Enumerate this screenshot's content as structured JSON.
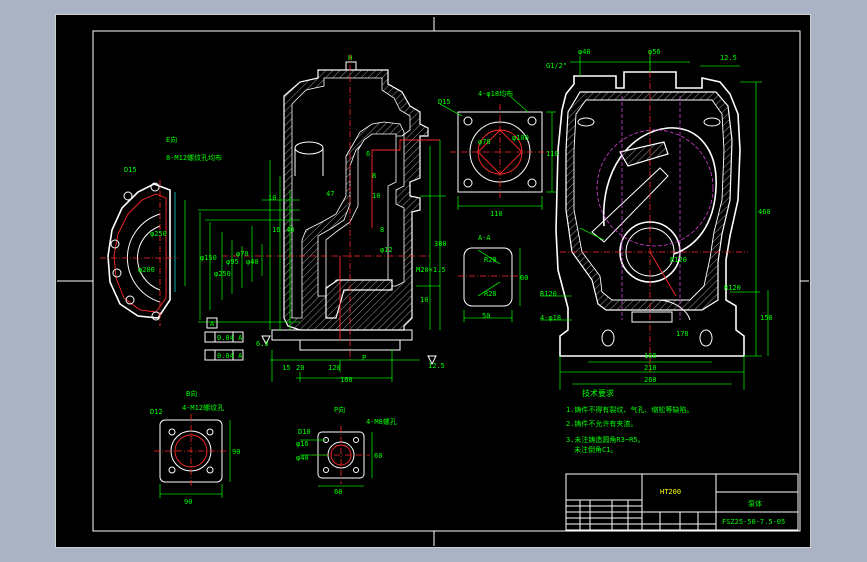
{
  "labels": {
    "e_view": "E向",
    "flange_holes": "8-M12螺纹孔均布",
    "d_left": "D15",
    "phi_left": "φ250",
    "phi_left_b": "φ200",
    "top_stub": "H",
    "dim_10": "10",
    "dim_47": "47",
    "dim_6": "6",
    "dim_8": "8",
    "dim_10b": "10",
    "dim_16": "16",
    "dim_40": "40",
    "dim_8b": "8",
    "dim_380": "380",
    "thread": "M20×1.5",
    "dim_10c": "10",
    "tol_a": "A",
    "tol_1": "0.04 A",
    "tol_2": "0.04 A",
    "rough_left": "6.3",
    "dim_15": "15",
    "dim_20": "20",
    "dim_120": "120",
    "dim_160": "160",
    "p_mark": "P",
    "rough_right": "12.5",
    "dim_phi12": "φ12",
    "dim_vert_1": "φ150",
    "dim_vert_2": "φ250",
    "dim_vert_3": "φ95",
    "dim_vert_4": "φ70",
    "dim_vert_5": "φ40",
    "d15": "D15",
    "holes_top": "4-φ18均布",
    "phi78": "φ78",
    "phi_top_flange": "φ100",
    "dim_110a": "110",
    "dim_110b": "110",
    "a_a": "A-A",
    "r_aa_1": "R20",
    "r_aa_2": "R20",
    "dim_50": "50",
    "dim_aa_v": "60",
    "phi40": "φ40",
    "phi_top_right": "φ56",
    "rough_top": "12.5",
    "thread_top": "G1/2\"",
    "dim_460": "460",
    "r120": "R120",
    "r_right": "R120",
    "dim_left_right": "4-φ18",
    "r_right_b": "R120",
    "dim_170": "170",
    "dim_160r": "160",
    "dim_210": "210",
    "dim_260": "260",
    "dim_150r": "150",
    "b_view": "B向",
    "b_d": "D12",
    "b_holes": "4-M12螺纹孔",
    "b_dim_90": "90",
    "b_dim_v": "90",
    "p_view": "P向",
    "p_holes": "4-M8螺孔",
    "p_d": "D10",
    "p_phi_1": "φ16",
    "p_phi_2": "φ40",
    "p_dim_60": "60",
    "p_dim_v": "60"
  },
  "notes": {
    "title": "技术要求",
    "items": [
      "1.铸件不得有裂纹、气孔、缩松等缺陷。",
      "2.铸件不允许有夹渣。",
      "3.未注铸造圆角R3~R5。",
      "  未注倒角C1。"
    ]
  },
  "title_block": {
    "material": "HT200",
    "part_name": "泵体",
    "drawing_no": "FSZ25-50-7.5-05"
  }
}
